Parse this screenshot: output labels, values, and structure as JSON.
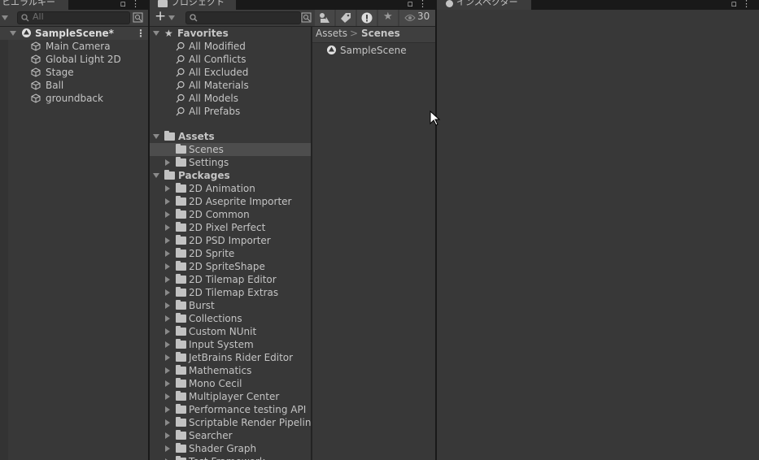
{
  "hierarchy": {
    "tab_label": "ヒエラルキー",
    "search_placeholder": "All",
    "scene": "SampleScene*",
    "items": [
      "Main Camera",
      "Global Light 2D",
      "Stage",
      "Ball",
      "groundback"
    ]
  },
  "project": {
    "tab_label": "プロジェクト",
    "add_label": "+",
    "hidden_count": "30",
    "favorites": {
      "label": "Favorites",
      "items": [
        "All Modified",
        "All Conflicts",
        "All Excluded",
        "All Materials",
        "All Models",
        "All Prefabs"
      ]
    },
    "assets": {
      "label": "Assets",
      "items": [
        "Scenes",
        "Settings"
      ]
    },
    "packages": {
      "label": "Packages",
      "items": [
        "2D Animation",
        "2D Aseprite Importer",
        "2D Common",
        "2D Pixel Perfect",
        "2D PSD Importer",
        "2D Sprite",
        "2D SpriteShape",
        "2D Tilemap Editor",
        "2D Tilemap Extras",
        "Burst",
        "Collections",
        "Custom NUnit",
        "Input System",
        "JetBrains Rider Editor",
        "Mathematics",
        "Mono Cecil",
        "Multiplayer Center",
        "Performance testing API",
        "Scriptable Render Pipeline",
        "Searcher",
        "Shader Graph",
        "Test Framework"
      ]
    },
    "breadcrumb": {
      "root": "Assets",
      "separator": ">",
      "current": "Scenes"
    },
    "content": [
      "SampleScene"
    ]
  },
  "inspector": {
    "tab_label": "インスペクター"
  },
  "colors": {
    "selected_row": "#4d4d4d",
    "panel_bg": "#383838",
    "tab_bg": "#3c3c3c",
    "text": "#c4c4c4"
  }
}
